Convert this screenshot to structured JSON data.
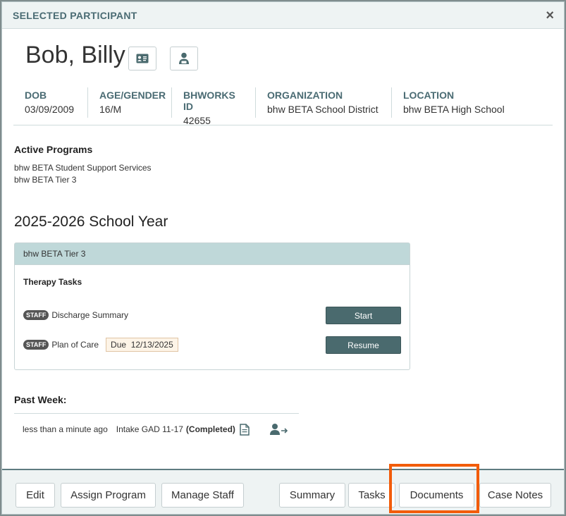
{
  "modal": {
    "title": "SELECTED PARTICIPANT",
    "close": "×"
  },
  "participant": {
    "name": "Bob, Billy",
    "icons": [
      "id-card-icon",
      "staff-person-icon"
    ]
  },
  "demographics": [
    {
      "label": "DOB",
      "value": "03/09/2009"
    },
    {
      "label": "AGE/GENDER",
      "value": "16/M"
    },
    {
      "label": "BHWORKS ID",
      "value": "42655"
    },
    {
      "label": "ORGANIZATION",
      "value": "bhw BETA School District"
    },
    {
      "label": "LOCATION",
      "value": "bhw BETA High School"
    }
  ],
  "active_programs": {
    "heading": "Active Programs",
    "items": [
      "bhw BETA Student Support Services",
      "bhw BETA Tier 3"
    ]
  },
  "school_year": "2025-2026 School Year",
  "program_card": {
    "title": "bhw BETA Tier 3",
    "subheading": "Therapy Tasks",
    "tasks": [
      {
        "badge": "STAFF",
        "name": "Discharge Summary",
        "due": "",
        "action": "Start"
      },
      {
        "badge": "STAFF",
        "name": "Plan of Care",
        "due": "Due  12/13/2025",
        "action": "Resume"
      }
    ]
  },
  "past_week": {
    "heading": "Past Week:",
    "items": [
      {
        "time": "less than a minute ago",
        "name": "Intake GAD 11-17",
        "status": "(Completed)"
      }
    ]
  },
  "footer": {
    "left_buttons": [
      "Edit",
      "Assign Program",
      "Manage Staff"
    ],
    "right_buttons": [
      "Summary",
      "Tasks",
      "Documents",
      "Case Notes"
    ]
  },
  "colors": {
    "accent": "#4a6b73",
    "button_dark": "#4a6a6e",
    "card_header": "#bfd8d9",
    "highlight": "#f25c0a"
  }
}
